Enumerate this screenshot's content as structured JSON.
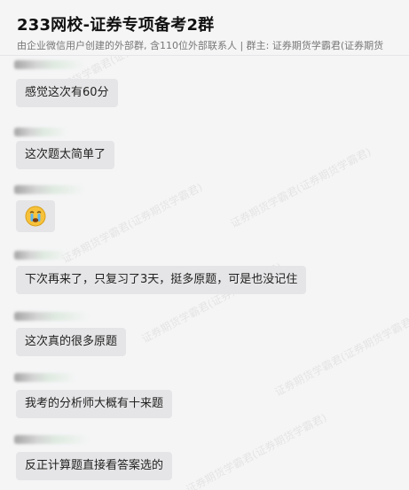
{
  "header": {
    "title": "233网校-证券专项备考2群",
    "subtitle": "由企业微信用户创建的外部群, 含110位外部联系人 | 群主: 证券期货学霸君(证券期货"
  },
  "messages": [
    {
      "text": "感觉这次有60分"
    },
    {
      "text": "这次题太简单了"
    },
    {
      "text": "",
      "icon": "crying-emoji-icon"
    },
    {
      "text": "下次再来了，只复习了3天，挺多原题，可是也没记住"
    },
    {
      "text": "这次真的很多原题"
    },
    {
      "text": "我考的分析师大概有十来题"
    },
    {
      "text": "反正计算题直接看答案选的"
    }
  ],
  "watermark": "证券期货学霸君(证券期货学霸君)",
  "colors": {
    "bubble": "#e5e5e7",
    "background": "#f5f5f6"
  }
}
